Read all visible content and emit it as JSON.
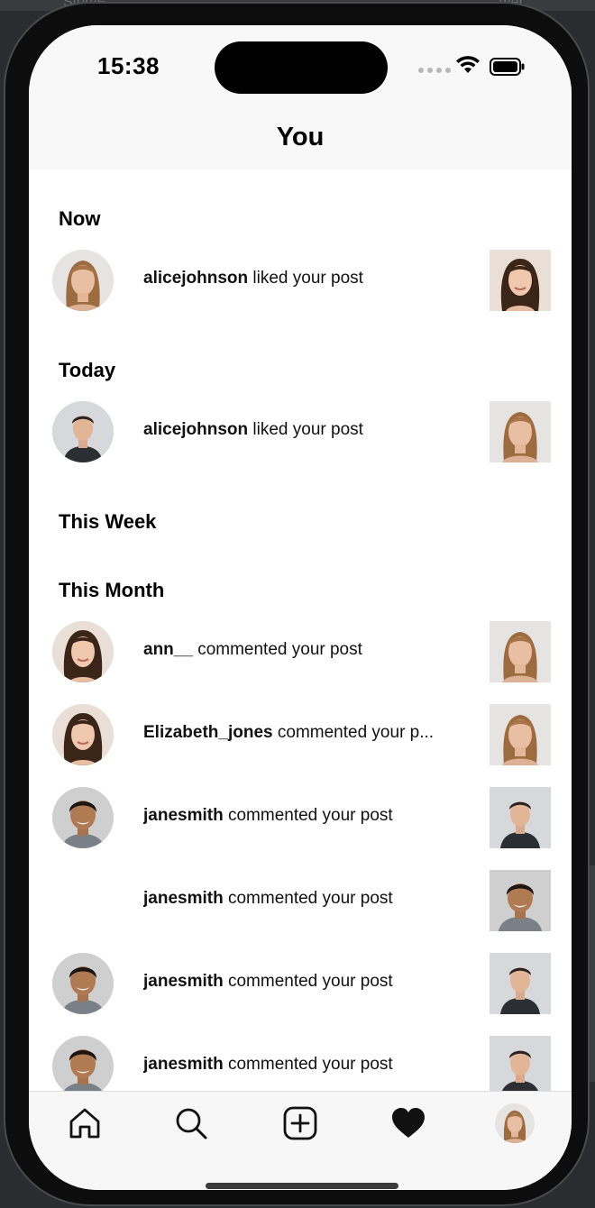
{
  "background": {
    "title_left": "StoryF...",
    "title_right": "...mer"
  },
  "status_bar": {
    "time": "15:38"
  },
  "header": {
    "title": "You"
  },
  "sections": [
    {
      "title": "Now"
    },
    {
      "title": "Today"
    },
    {
      "title": "This Week"
    },
    {
      "title": "This Month"
    }
  ],
  "notifications": [
    {
      "username": "alicejohnson",
      "action": "liked your post",
      "avatar": "woman-blonde",
      "thumb": "woman-brunette"
    },
    {
      "username": "alicejohnson",
      "action": "liked your post",
      "avatar": "man-dark-shirt",
      "thumb": "woman-blonde"
    },
    {
      "username": "ann__",
      "action": "commented your post",
      "avatar": "woman-brunette",
      "thumb": "woman-blonde"
    },
    {
      "username": "Elizabeth_jones",
      "action": "commented your p...",
      "avatar": "woman-brunette",
      "thumb": "woman-blonde"
    },
    {
      "username": "janesmith",
      "action": "commented your post",
      "avatar": "man-smiling",
      "thumb": "man-dark-shirt"
    },
    {
      "username": "janesmith",
      "action": "commented your post",
      "avatar": "",
      "thumb": "man-smiling"
    },
    {
      "username": "janesmith",
      "action": "commented your post",
      "avatar": "man-smiling",
      "thumb": "man-dark-shirt"
    },
    {
      "username": "janesmith",
      "action": "commented your post",
      "avatar": "man-smiling",
      "thumb": "man-dark-shirt"
    }
  ],
  "tabbar": {
    "items": [
      "home-icon",
      "search-icon",
      "add-post-icon",
      "heart-icon",
      "profile-avatar"
    ],
    "active": "heart-icon"
  },
  "colors": {
    "text": "#000000",
    "header_bg": "#f8f8f8",
    "tabbar_bg": "#f7f7f7"
  }
}
